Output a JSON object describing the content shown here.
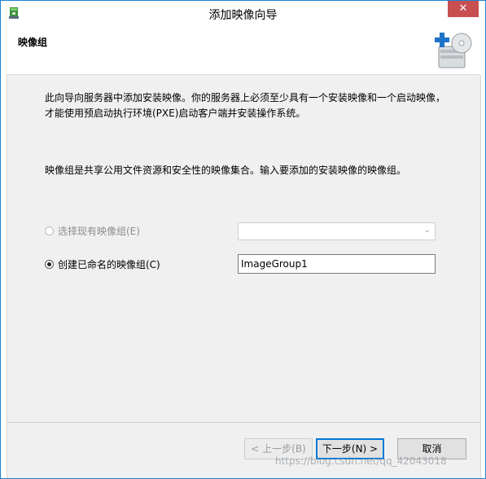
{
  "window": {
    "title": "添加映像向导",
    "close_label": "✕"
  },
  "header": {
    "title": "映像组"
  },
  "content": {
    "intro": "此向导向服务器中添加安装映像。你的服务器上必须至少具有一个安装映像和一个启动映像，才能使用预启动执行环境(PXE)启动客户端并安装操作系统。",
    "description": "映像组是共享公用文件资源和安全性的映像集合。输入要添加的安装映像的映像组。",
    "option_existing": {
      "label": "选择现有映像组(E)",
      "selected": false,
      "enabled": false
    },
    "existing_select": {
      "value": ""
    },
    "option_new": {
      "label": "创建已命名的映像组(C)",
      "selected": true,
      "enabled": true
    },
    "new_group_input": {
      "value": "ImageGroup1"
    }
  },
  "footer": {
    "back_label": "< 上一步(B)",
    "next_label": "下一步(N) >",
    "cancel_label": "取消"
  },
  "watermark": "https://blog.csdn.net/qq_42043018",
  "colors": {
    "accent": "#0078d7",
    "close": "#c74f50",
    "border": "#1883d7"
  }
}
